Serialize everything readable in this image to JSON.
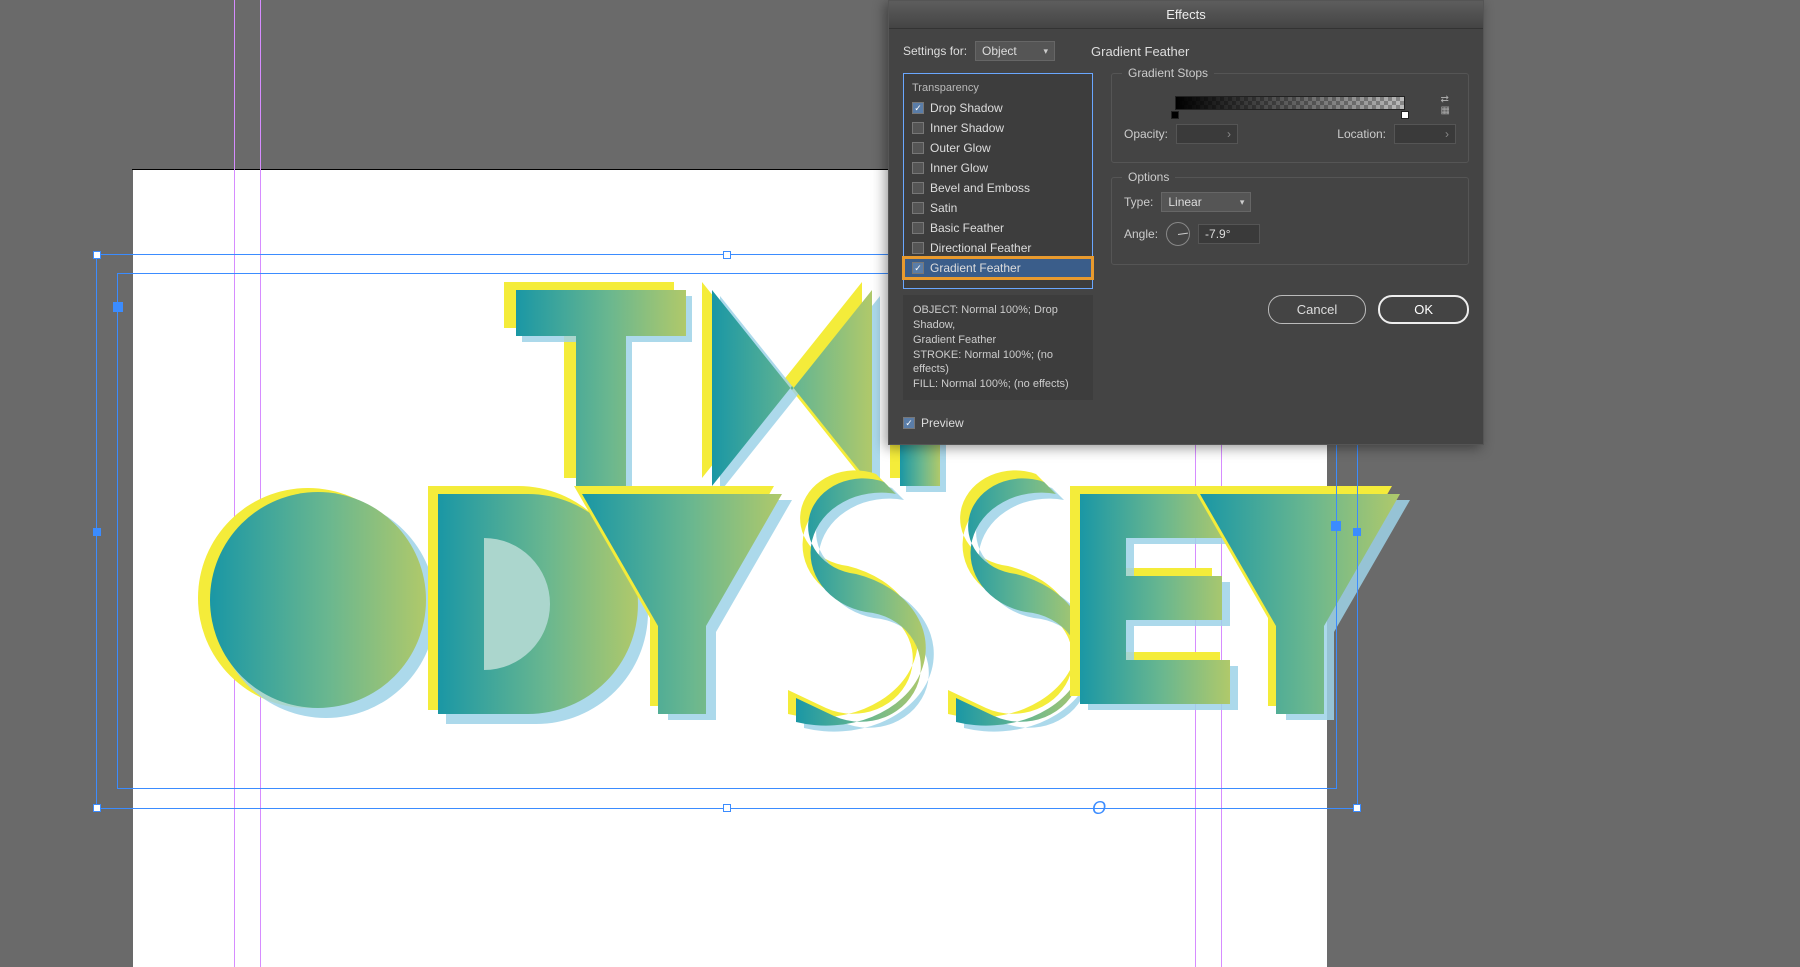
{
  "dialog": {
    "title": "Effects",
    "settings_label": "Settings for:",
    "settings_value": "Object",
    "section_title": "Gradient Feather",
    "fx_header": "Transparency",
    "fx": [
      {
        "label": "Drop Shadow",
        "checked": true
      },
      {
        "label": "Inner Shadow",
        "checked": false
      },
      {
        "label": "Outer Glow",
        "checked": false
      },
      {
        "label": "Inner Glow",
        "checked": false
      },
      {
        "label": "Bevel and Emboss",
        "checked": false
      },
      {
        "label": "Satin",
        "checked": false
      },
      {
        "label": "Basic Feather",
        "checked": false
      },
      {
        "label": "Directional Feather",
        "checked": false
      },
      {
        "label": "Gradient Feather",
        "checked": true
      }
    ],
    "summary": {
      "l1": "OBJECT: Normal 100%; Drop Shadow,",
      "l2": "Gradient Feather",
      "l3": "STROKE: Normal 100%; (no effects)",
      "l4": "FILL: Normal 100%; (no effects)"
    },
    "preview_label": "Preview",
    "stops_legend": "Gradient Stops",
    "opacity_label": "Opacity:",
    "opacity_value": "",
    "location_label": "Location:",
    "location_value": "",
    "options_legend": "Options",
    "type_label": "Type:",
    "type_value": "Linear",
    "angle_label": "Angle:",
    "angle_value": "-7.9°",
    "cancel": "Cancel",
    "ok": "OK"
  },
  "artwork": {
    "line1": "THE",
    "line2": "ODYSSEY",
    "overset_glyph": "O"
  }
}
